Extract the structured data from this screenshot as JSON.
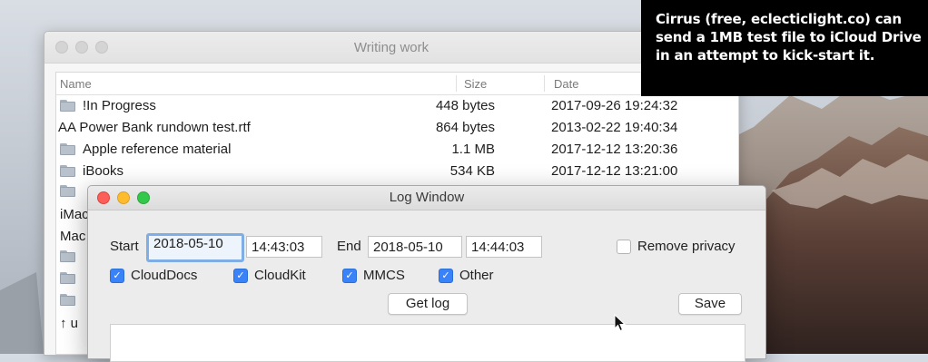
{
  "back_window": {
    "title": "Writing work",
    "columns": {
      "name": "Name",
      "size": "Size",
      "date": "Date"
    },
    "rows": [
      {
        "folder": true,
        "name": "!In Progress",
        "size": "448 bytes",
        "date": "2017-09-26 19:24:32"
      },
      {
        "folder": false,
        "name": "AA Power Bank rundown test.rtf",
        "size": "864 bytes",
        "date": "2013-02-22 19:40:34"
      },
      {
        "folder": true,
        "name": "Apple reference material",
        "size": "1.1 MB",
        "date": "2017-12-12 13:20:36"
      },
      {
        "folder": true,
        "name": "iBooks",
        "size": "534 KB",
        "date": "2017-12-12 13:21:00"
      }
    ],
    "partial_rows": [
      "iMac",
      "Mac",
      "↑ u"
    ]
  },
  "log_window": {
    "title": "Log Window",
    "start_label": "Start",
    "start_date": "2018-05-10",
    "start_time": "14:43:03",
    "end_label": "End",
    "end_date": "2018-05-10",
    "end_time": "14:44:03",
    "remove_privacy": {
      "label": "Remove privacy",
      "checked": false
    },
    "checkboxes": [
      {
        "label": "CloudDocs",
        "checked": true
      },
      {
        "label": "CloudKit",
        "checked": true
      },
      {
        "label": "MMCS",
        "checked": true
      },
      {
        "label": "Other",
        "checked": true
      }
    ],
    "get_log_button": "Get log",
    "save_button": "Save"
  },
  "caption": {
    "line1": "Cirrus (free, eclecticlight.co) can",
    "line2": "send a 1MB test file to iCloud Drive",
    "line3": "in an attempt to kick-start it."
  },
  "colors": {
    "accent": "#3a82f7",
    "focus_ring": "#7eaee3",
    "close": "#fc5f57",
    "minimize": "#fdbc2e",
    "zoom": "#34c84a"
  }
}
